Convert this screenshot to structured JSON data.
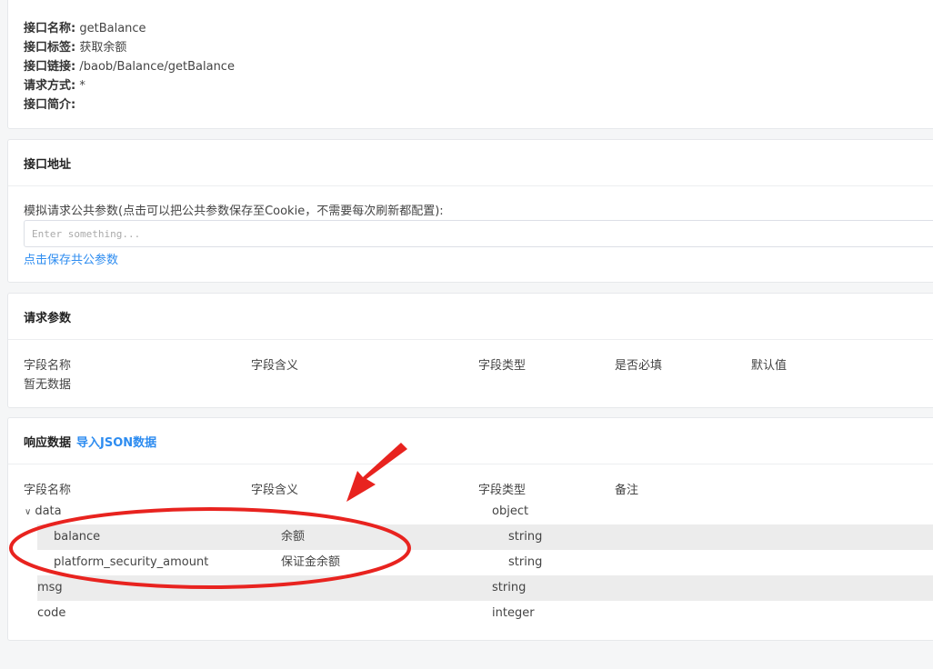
{
  "info": {
    "name_label": "接口名称:",
    "name_value": "getBalance",
    "tag_label": "接口标签:",
    "tag_value": "获取余额",
    "link_label": "接口链接:",
    "link_value": "/baob/Balance/getBalance",
    "method_label": "请求方式:",
    "method_value": "*",
    "desc_label": "接口简介:",
    "desc_value": ""
  },
  "address": {
    "title": "接口地址",
    "params_label": "模拟请求公共参数(点击可以把公共参数保存至Cookie，不需要每次刷新都配置):",
    "input_placeholder": "Enter something...",
    "save_link": "点击保存共公参数"
  },
  "request": {
    "title": "请求参数",
    "columns": [
      "字段名称",
      "字段含义",
      "字段类型",
      "是否必填",
      "默认值"
    ],
    "empty_text": "暂无数据"
  },
  "response": {
    "title": "响应数据",
    "import_link": "导入JSON数据",
    "columns": [
      "字段名称",
      "字段含义",
      "字段类型",
      "备注"
    ],
    "rows": [
      {
        "name": "data",
        "meaning": "",
        "type": "object",
        "expanded": true
      },
      {
        "name": "balance",
        "meaning": "余额",
        "type": "string"
      },
      {
        "name": "platform_security_amount",
        "meaning": "保证金余额",
        "type": "string"
      },
      {
        "name": "msg",
        "meaning": "",
        "type": "string"
      },
      {
        "name": "code",
        "meaning": "",
        "type": "integer"
      }
    ]
  },
  "colors": {
    "link": "#2d8cf0",
    "annotation": "#e8231f",
    "row_shade": "#ececec"
  }
}
